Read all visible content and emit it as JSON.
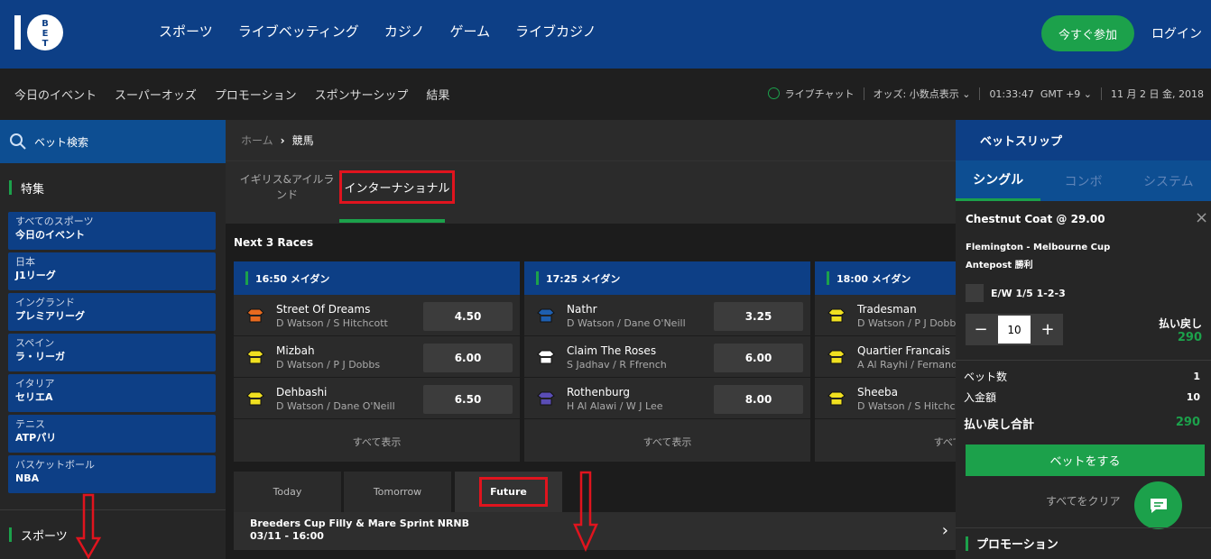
{
  "brand": {
    "logo": "10 BET"
  },
  "topnav": [
    "スポーツ",
    "ライブベッティング",
    "カジノ",
    "ゲーム",
    "ライブカジノ"
  ],
  "header": {
    "join_label": "今すぐ参加",
    "login_label": "ログイン"
  },
  "subnav": [
    "今日のイベント",
    "スーパーオッズ",
    "プロモーション",
    "スポンサーシップ",
    "結果"
  ],
  "utility": {
    "live_chat": "ライブチャット",
    "odds_format": "オッズ: 小数点表示",
    "time": "01:33:47",
    "timezone": "GMT +9",
    "date": "11 月 2 日 金, 2018"
  },
  "sidebar": {
    "search_label": "ベット検索",
    "featured_title": "特集",
    "items": [
      {
        "line1": "すべてのスポーツ",
        "line2": "今日のイベント"
      },
      {
        "line1": "日本",
        "line2": "J1リーグ"
      },
      {
        "line1": "イングランド",
        "line2": "プレミアリーグ"
      },
      {
        "line1": "スペイン",
        "line2": "ラ・リーガ"
      },
      {
        "line1": "イタリア",
        "line2": "セリエA"
      },
      {
        "line1": "テニス",
        "line2": "ATPパリ"
      },
      {
        "line1": "バスケットボール",
        "line2": "NBA"
      }
    ],
    "sports_title": "スポーツ"
  },
  "breadcrumb": {
    "home": "ホーム",
    "current": "競馬"
  },
  "region_tabs": {
    "uk": "イギリス&アイルランド",
    "international": "インターナショナル"
  },
  "next_races_title": "Next 3 Races",
  "races": [
    {
      "title": "16:50 メイダン",
      "show_all": "すべて表示",
      "runners": [
        {
          "name": "Street Of Dreams",
          "jockey": "D Watson / S Hitchcott",
          "odds": "4.50",
          "silk_color": "#e86a1f"
        },
        {
          "name": "Mizbah",
          "jockey": "D Watson / P J Dobbs",
          "odds": "6.00",
          "silk_color": "#f0e020"
        },
        {
          "name": "Dehbashi",
          "jockey": "D Watson / Dane O'Neill",
          "odds": "6.50",
          "silk_color": "#f0e020"
        }
      ]
    },
    {
      "title": "17:25 メイダン",
      "show_all": "すべて表示",
      "runners": [
        {
          "name": "Nathr",
          "jockey": "D Watson / Dane O'Neill",
          "odds": "3.25",
          "silk_color": "#1e5fb0"
        },
        {
          "name": "Claim The Roses",
          "jockey": "S Jadhav / R Ffrench",
          "odds": "6.00",
          "silk_color": "#ffffff"
        },
        {
          "name": "Rothenburg",
          "jockey": "H Al Alawi / W J Lee",
          "odds": "8.00",
          "silk_color": "#5a4db5"
        }
      ]
    },
    {
      "title": "18:00 メイダン",
      "show_all": "すべて表示",
      "runners": [
        {
          "name": "Tradesman",
          "jockey": "D Watson / P J Dobbs",
          "odds": "",
          "silk_color": "#f0e020"
        },
        {
          "name": "Quartier Francais",
          "jockey": "A Al Rayhi / Fernando Jara",
          "odds": "",
          "silk_color": "#f0e020"
        },
        {
          "name": "Sheeba",
          "jockey": "D Watson / S Hitchcott",
          "odds": "",
          "silk_color": "#f0e020"
        }
      ]
    }
  ],
  "day_tabs": [
    "Today",
    "Tomorrow",
    "Future"
  ],
  "future_event": {
    "title": "Breeders Cup Filly & Mare Sprint NRNB",
    "datetime": "03/11  -  16:00"
  },
  "betslip": {
    "title": "ベットスリップ",
    "tabs": [
      "シングル",
      "コンボ",
      "システム"
    ],
    "selection": "Chestnut Coat  @ 29.00",
    "event": "Flemington - Melbourne Cup",
    "market": "Antepost 勝利",
    "ew_label": "E/W 1/5 1-2-3",
    "stake": "10",
    "returns_label": "払い戻し",
    "returns_value": "290",
    "bet_count_label": "ベット数",
    "bet_count": "1",
    "stake_label": "入金額",
    "stake_total": "10",
    "total_returns_label": "払い戻し合計",
    "total_returns": "290",
    "place_bet": "ベットをする",
    "clear_all": "すべてをクリア",
    "promotions_title": "プロモーション"
  },
  "colors": {
    "brand_blue": "#0d3f86",
    "accent_green": "#1ca14b",
    "highlight_red": "#e0141e"
  }
}
